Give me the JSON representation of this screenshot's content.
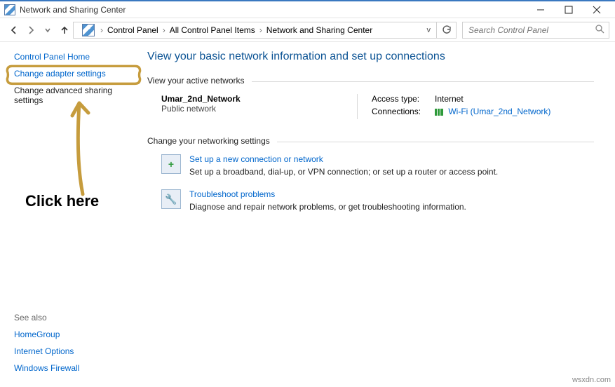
{
  "window": {
    "title": "Network and Sharing Center"
  },
  "breadcrumb": {
    "items": [
      "Control Panel",
      "All Control Panel Items",
      "Network and Sharing Center"
    ]
  },
  "search": {
    "placeholder": "Search Control Panel"
  },
  "sidebar": {
    "home": "Control Panel Home",
    "adapter": "Change adapter settings",
    "advanced": "Change advanced sharing settings",
    "seealso_label": "See also",
    "seealso": [
      "HomeGroup",
      "Internet Options",
      "Windows Firewall"
    ]
  },
  "main": {
    "heading": "View your basic network information and set up connections",
    "active_section": "View your active networks",
    "network": {
      "name": "Umar_2nd_Network",
      "type": "Public network",
      "access_label": "Access type:",
      "access_value": "Internet",
      "conn_label": "Connections:",
      "conn_value": "Wi-Fi (Umar_2nd_Network)"
    },
    "change_section": "Change your networking settings",
    "tasks": [
      {
        "link": "Set up a new connection or network",
        "desc": "Set up a broadband, dial-up, or VPN connection; or set up a router or access point."
      },
      {
        "link": "Troubleshoot problems",
        "desc": "Diagnose and repair network problems, or get troubleshooting information."
      }
    ]
  },
  "annotation": {
    "text": "Click here"
  },
  "watermark": "wsxdn.com"
}
